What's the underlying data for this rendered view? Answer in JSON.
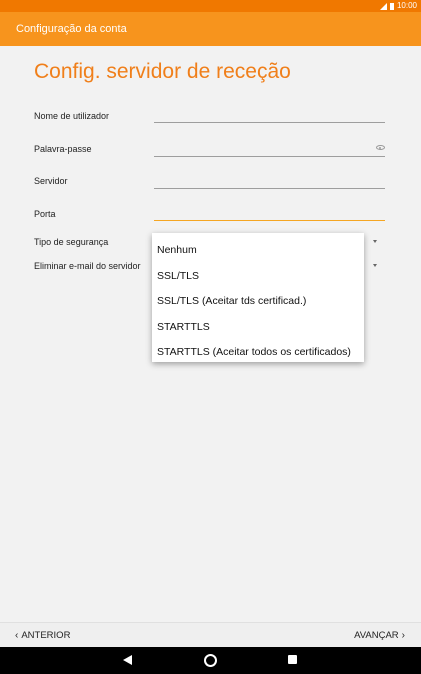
{
  "status_bar": {
    "time": "10:00",
    "icons": [
      "signal-icon",
      "battery-icon"
    ]
  },
  "app_bar": {
    "title": "Configuração da conta"
  },
  "page": {
    "title": "Config. servidor de receção"
  },
  "fields": [
    {
      "label": "Nome de utilizador",
      "value": ""
    },
    {
      "label": "Palavra-passe",
      "value": ""
    },
    {
      "label": "Servidor",
      "value": ""
    },
    {
      "label": "Porta",
      "value": ""
    },
    {
      "label": "Tipo de segurança",
      "value": ""
    },
    {
      "label": "Eliminar e-mail do servidor",
      "value": ""
    }
  ],
  "dropdown": {
    "options": [
      "Nenhum",
      "SSL/TLS",
      "SSL/TLS (Aceitar tds certificad.)",
      "STARTTLS",
      "STARTTLS (Aceitar todos os certificados)"
    ]
  },
  "bottom_bar": {
    "prev_label": "ANTERIOR",
    "next_label": "AVANÇAR"
  },
  "colors": {
    "accent": "#f7941d",
    "status_bar": "#f07800",
    "title": "#f07f1a",
    "focus_line": "#f5a623"
  }
}
